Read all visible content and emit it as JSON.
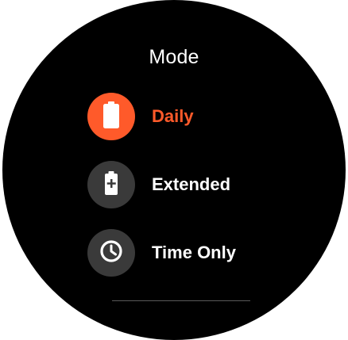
{
  "screen": {
    "title": "Mode"
  },
  "options": [
    {
      "label": "Daily",
      "icon": "battery-icon",
      "selected": true,
      "circle_color": "#ff5a2a"
    },
    {
      "label": "Extended",
      "icon": "battery-plus-icon",
      "selected": false,
      "circle_color": "#3a3a3a"
    },
    {
      "label": "Time Only",
      "icon": "clock-icon",
      "selected": false,
      "circle_color": "#3a3a3a"
    }
  ],
  "colors": {
    "accent": "#ff5a2a",
    "background": "#000000",
    "text": "#ffffff",
    "icon_circle": "#3a3a3a"
  }
}
